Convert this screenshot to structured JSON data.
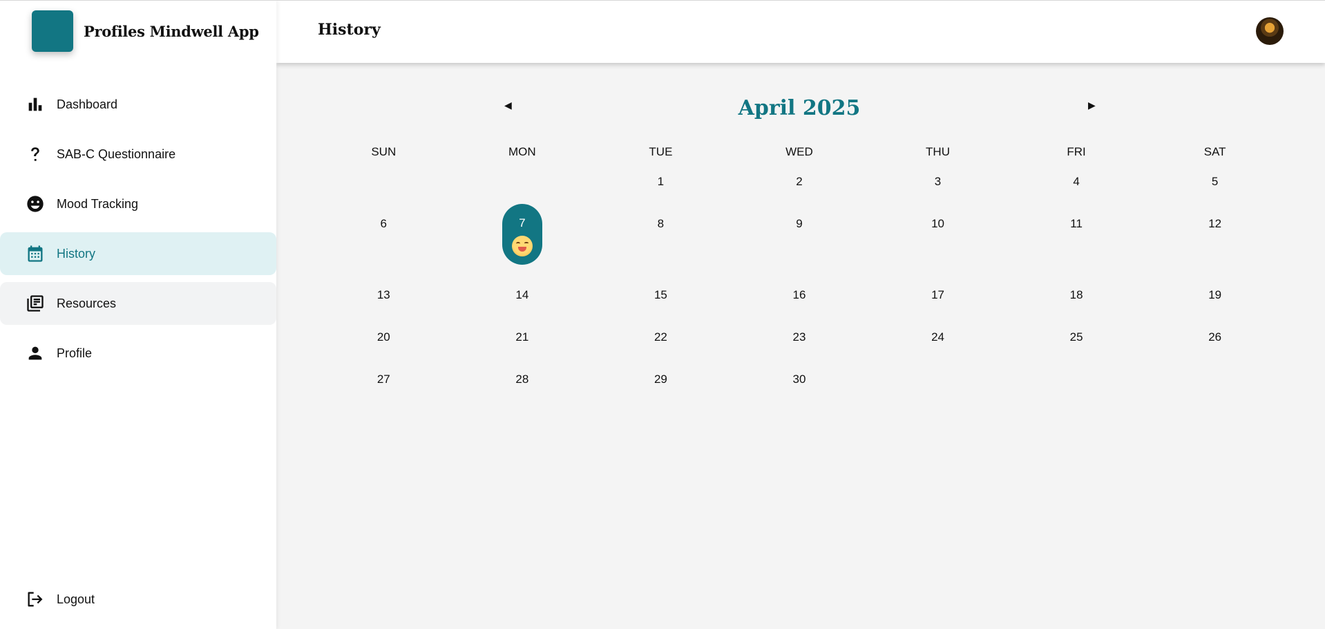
{
  "app": {
    "name": "Profiles Mindwell App",
    "brand_color": "#127683"
  },
  "sidebar": {
    "items": [
      {
        "label": "Dashboard",
        "icon": "bar-chart-icon"
      },
      {
        "label": "SAB-C Questionnaire",
        "icon": "question-mark-icon"
      },
      {
        "label": "Mood Tracking",
        "icon": "smiley-icon"
      },
      {
        "label": "History",
        "icon": "calendar-icon",
        "active": true
      },
      {
        "label": "Resources",
        "icon": "library-books-icon"
      },
      {
        "label": "Profile",
        "icon": "person-icon"
      }
    ],
    "logout": {
      "label": "Logout",
      "icon": "logout-icon"
    }
  },
  "header": {
    "title": "History"
  },
  "calendar": {
    "month_title": "April 2025",
    "prev_glyph": "◀",
    "next_glyph": "▶",
    "weekdays": [
      "SUN",
      "MON",
      "TUE",
      "WED",
      "THU",
      "FRI",
      "SAT"
    ],
    "weeks": [
      [
        "",
        "",
        "1",
        "2",
        "3",
        "4",
        "5"
      ],
      [
        "6",
        "7",
        "8",
        "9",
        "10",
        "11",
        "12"
      ],
      [
        "13",
        "14",
        "15",
        "16",
        "17",
        "18",
        "19"
      ],
      [
        "20",
        "21",
        "22",
        "23",
        "24",
        "25",
        "26"
      ],
      [
        "27",
        "28",
        "29",
        "30",
        "",
        "",
        ""
      ]
    ],
    "selected_day": "7",
    "selected_mood_icon": "happy-face-emoji-icon"
  }
}
